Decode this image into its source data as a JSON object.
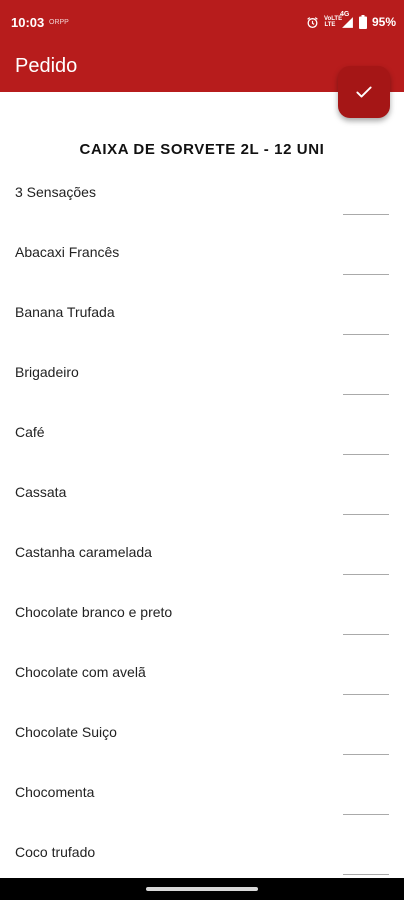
{
  "status_bar": {
    "time": "10:03",
    "extra": "ORPP",
    "network_type": "4G",
    "lte_line1": "VoLTE",
    "lte_line2": "LTE",
    "battery": "95%"
  },
  "app_bar": {
    "title": "Pedido"
  },
  "section": {
    "title": "CAIXA DE SORVETE 2L - 12 UNI"
  },
  "flavors": [
    {
      "name": "3 Sensações",
      "qty": ""
    },
    {
      "name": "Abacaxi Francês",
      "qty": ""
    },
    {
      "name": "Banana Trufada",
      "qty": ""
    },
    {
      "name": "Brigadeiro",
      "qty": ""
    },
    {
      "name": "Café",
      "qty": ""
    },
    {
      "name": "Cassata",
      "qty": ""
    },
    {
      "name": "Castanha caramelada",
      "qty": ""
    },
    {
      "name": "Chocolate branco e preto",
      "qty": ""
    },
    {
      "name": "Chocolate com avelã",
      "qty": ""
    },
    {
      "name": "Chocolate Suiço",
      "qty": ""
    },
    {
      "name": "Chocomenta",
      "qty": ""
    },
    {
      "name": "Coco trufado",
      "qty": ""
    }
  ],
  "colors": {
    "primary": "#b71c1c",
    "fab": "#a51616"
  }
}
